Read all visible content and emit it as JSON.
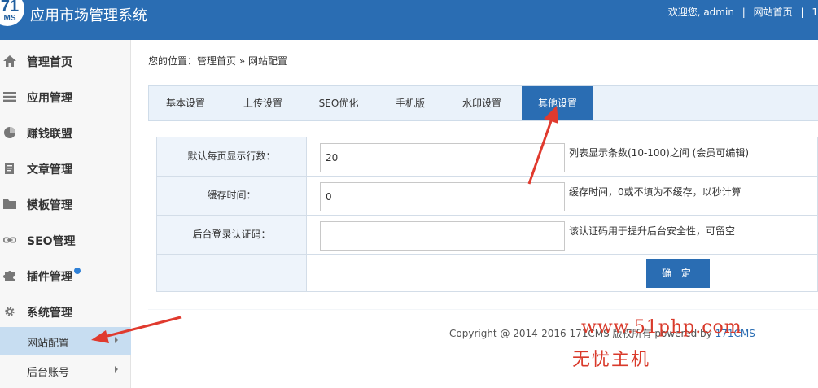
{
  "header": {
    "logo_text_top": "71",
    "logo_text_bottom": "MS",
    "title": "应用市场管理系统",
    "welcome": "欢迎您, admin",
    "sep": "|",
    "home_link": "网站首页",
    "trailing": "1"
  },
  "sidebar": {
    "items": [
      {
        "label": "管理首页",
        "icon": "home-icon"
      },
      {
        "label": "应用管理",
        "icon": "list-icon"
      },
      {
        "label": "赚钱联盟",
        "icon": "pie-chart-icon"
      },
      {
        "label": "文章管理",
        "icon": "document-icon"
      },
      {
        "label": "模板管理",
        "icon": "folder-icon"
      },
      {
        "label": "SEO管理",
        "icon": "link-icon"
      },
      {
        "label": "插件管理",
        "icon": "puzzle-icon"
      },
      {
        "label": "系统管理",
        "icon": "gear-icon"
      }
    ],
    "sub_items": [
      {
        "label": "网站配置",
        "active": true
      },
      {
        "label": "后台账号",
        "active": false
      }
    ]
  },
  "breadcrumb": "您的位置：管理首页 » 网站配置",
  "tabs": [
    {
      "label": "基本设置"
    },
    {
      "label": "上传设置"
    },
    {
      "label": "SEO优化"
    },
    {
      "label": "手机版"
    },
    {
      "label": "水印设置"
    },
    {
      "label": "其他设置",
      "active": true
    }
  ],
  "form": {
    "rows": [
      {
        "label": "默认每页显示行数：",
        "value": "20",
        "hint": "列表显示条数(10-100)之间 (会员可编辑)"
      },
      {
        "label": "缓存时间：",
        "value": "0",
        "hint": "缓存时间，0或不填为不缓存，以秒计算"
      },
      {
        "label": "后台登录认证码：",
        "value": "",
        "hint": "该认证码用于提升后台安全性，可留空"
      }
    ],
    "confirm": "确 定"
  },
  "footer": {
    "text": "Copyright @ 2014-2016 171CMS 版权所有 powered by",
    "link": "171CMS"
  },
  "watermark": {
    "line1": "www.51php.com",
    "line2": "无忧主机"
  },
  "colors": {
    "header_bg": "#2a6db3",
    "active_tab": "#2a6db3",
    "active_sub_item": "#c7ddf1",
    "annotation_arrow": "#e03a2e"
  }
}
